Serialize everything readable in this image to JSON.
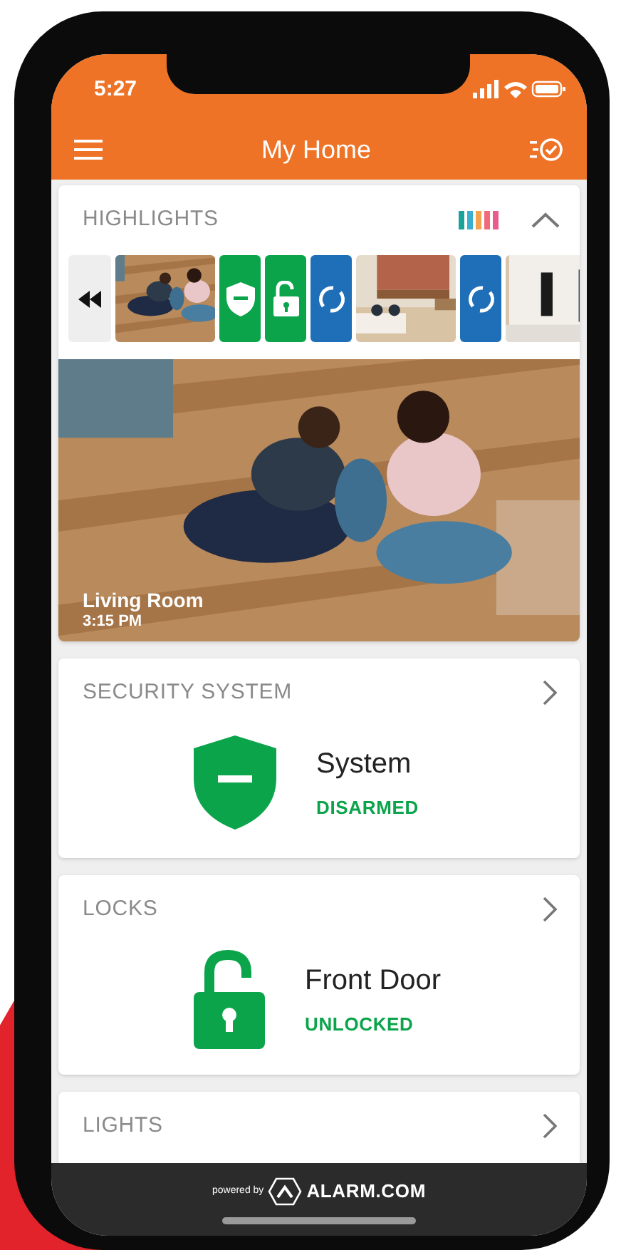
{
  "status_bar": {
    "time": "5:27"
  },
  "header": {
    "title": "My Home"
  },
  "highlights": {
    "title": "HIGHLIGHTS",
    "expanded": true,
    "thumbnails": [
      {
        "kind": "rewind"
      },
      {
        "kind": "picture"
      },
      {
        "kind": "security"
      },
      {
        "kind": "lock"
      },
      {
        "kind": "sync"
      },
      {
        "kind": "picture"
      },
      {
        "kind": "sync"
      },
      {
        "kind": "picture"
      }
    ],
    "featured": {
      "kind": "picture",
      "caption": "Living Room",
      "time": "3:15 PM"
    }
  },
  "cards": [
    {
      "kind": "security",
      "title": "SECURITY SYSTEM",
      "name": "System",
      "status": "DISARMED"
    },
    {
      "kind": "lock",
      "title": "LOCKS",
      "name": "Front Door",
      "status": "UNLOCKED"
    },
    {
      "kind": "collapsed",
      "title": "LIGHTS"
    }
  ],
  "footer": {
    "powered": "powered by",
    "brand": "ALARM.COM"
  }
}
